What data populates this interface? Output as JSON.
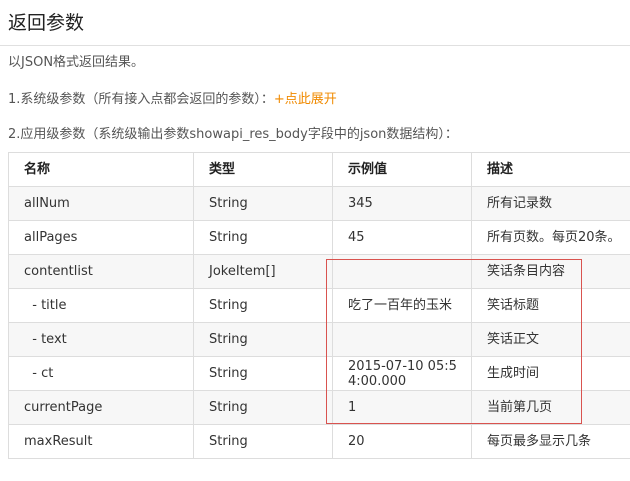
{
  "page": {
    "title": "返回参数",
    "description": "以JSON格式返回结果。",
    "system_params": {
      "label": "1.系统级参数（所有接入点都会返回的参数）：",
      "link": "+点此展开"
    },
    "app_params": {
      "label": "2.应用级参数（系统级输出参数showapi_res_body字段中的json数据结构）："
    }
  },
  "table": {
    "headers": [
      "名称",
      "类型",
      "示例值",
      "描述"
    ],
    "rows": [
      {
        "name": "allNum",
        "type": "String",
        "example": "345",
        "desc": "所有记录数"
      },
      {
        "name": "allPages",
        "type": "String",
        "example": "45",
        "desc": "所有页数。每页20条。"
      },
      {
        "name": "contentlist",
        "type": "JokeItem[]",
        "example": "",
        "desc": "笑话条目内容"
      },
      {
        "name": "  - title",
        "type": "String",
        "example": "吃了一百年的玉米",
        "desc": "笑话标题"
      },
      {
        "name": "  - text",
        "type": "String",
        "example": "",
        "desc": "笑话正文"
      },
      {
        "name": "  - ct",
        "type": "String",
        "example": "2015-07-10 05:54:00.000",
        "desc": "生成时间"
      },
      {
        "name": "currentPage",
        "type": "String",
        "example": "1",
        "desc": "当前第几页"
      },
      {
        "name": "maxResult",
        "type": "String",
        "example": "20",
        "desc": "每页最多显示几条"
      }
    ]
  },
  "colors": {
    "link": "#f08a00",
    "highlight_border": "#d9534f",
    "row_stripe": "#f7f7f7",
    "border": "#dddddd"
  }
}
